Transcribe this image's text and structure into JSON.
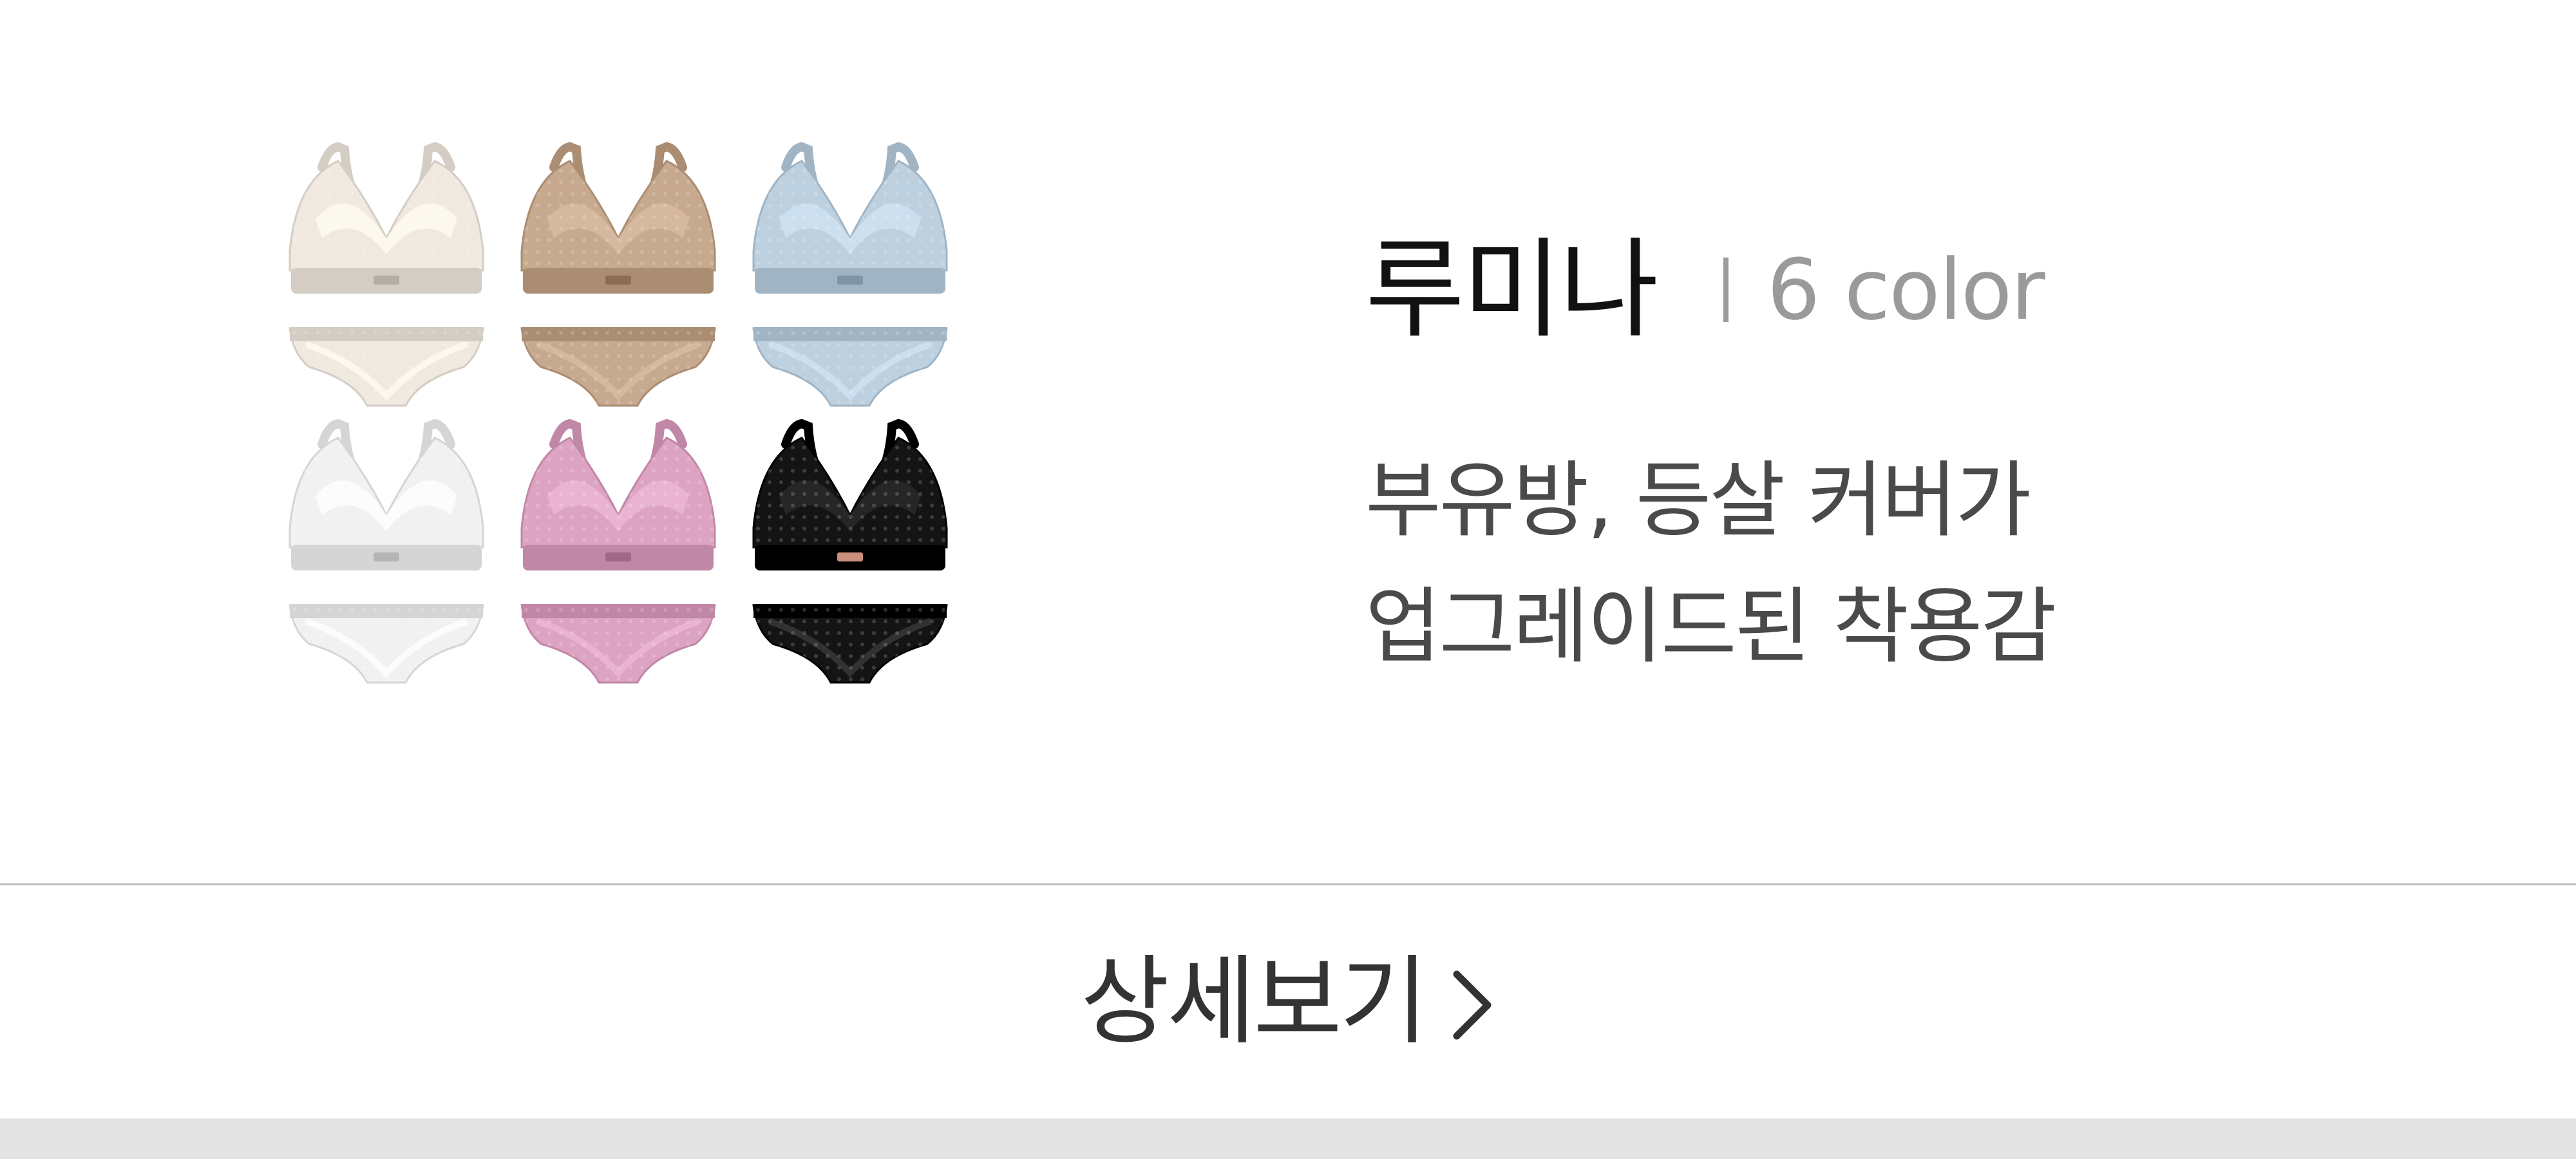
{
  "product": {
    "name": "루미나",
    "color_count": "6 color",
    "description_lines": [
      "부유방, 등살 커버가",
      "업그레이드된 착용감"
    ],
    "image": {
      "icon": "lingerie-set-image",
      "swatches": [
        "#efe9df",
        "#c7a98f",
        "#bcd0e0",
        "#f1f1f1",
        "#dca4c2",
        "#141414"
      ]
    }
  },
  "detail_button": {
    "label": "상세보기",
    "icon": "chevron-right-icon"
  },
  "colors": {
    "title": "#111111",
    "subtitle": "#9a9a9a",
    "description": "#4a4a4a",
    "divider": "#bdbdbd",
    "footer_bar": "#e3e3e3"
  }
}
